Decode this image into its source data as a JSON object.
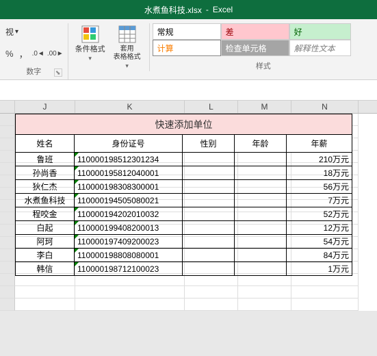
{
  "titlebar": {
    "filename": "水煮鱼科技.xlsx",
    "dash": "-",
    "app": "Excel"
  },
  "ribbon": {
    "view_label": "视",
    "number_group": "数字",
    "cond_fmt": "条件格式",
    "table_fmt": "套用\n表格格式",
    "styles_group": "样式",
    "style_cells": {
      "normal": "常规",
      "bad": "差",
      "good": "好",
      "calc": "计算",
      "check": "检查单元格",
      "explain": "解释性文本"
    }
  },
  "columns": [
    "J",
    "K",
    "L",
    "M",
    "N"
  ],
  "table": {
    "title": "快速添加单位",
    "headers": {
      "name": "姓名",
      "id": "身份证号",
      "sex": "性别",
      "age": "年龄",
      "salary": "年薪"
    },
    "rows": [
      {
        "name": "鲁班",
        "id": "110000198512301234",
        "salary": "210万元"
      },
      {
        "name": "孙尚香",
        "id": "110000195812040001",
        "salary": "18万元"
      },
      {
        "name": "狄仁杰",
        "id": "110000198308300001",
        "salary": "56万元"
      },
      {
        "name": "水煮鱼科技",
        "id": "110000194505080021",
        "salary": "7万元"
      },
      {
        "name": "程咬金",
        "id": "110000194202010032",
        "salary": "52万元"
      },
      {
        "name": "白起",
        "id": "110000199408200013",
        "salary": "12万元"
      },
      {
        "name": "阿珂",
        "id": "110000197409200023",
        "salary": "54万元"
      },
      {
        "name": "李白",
        "id": "110000198808080001",
        "salary": "84万元"
      },
      {
        "name": "韩信",
        "id": "110000198712100023",
        "salary": "1万元"
      }
    ]
  }
}
